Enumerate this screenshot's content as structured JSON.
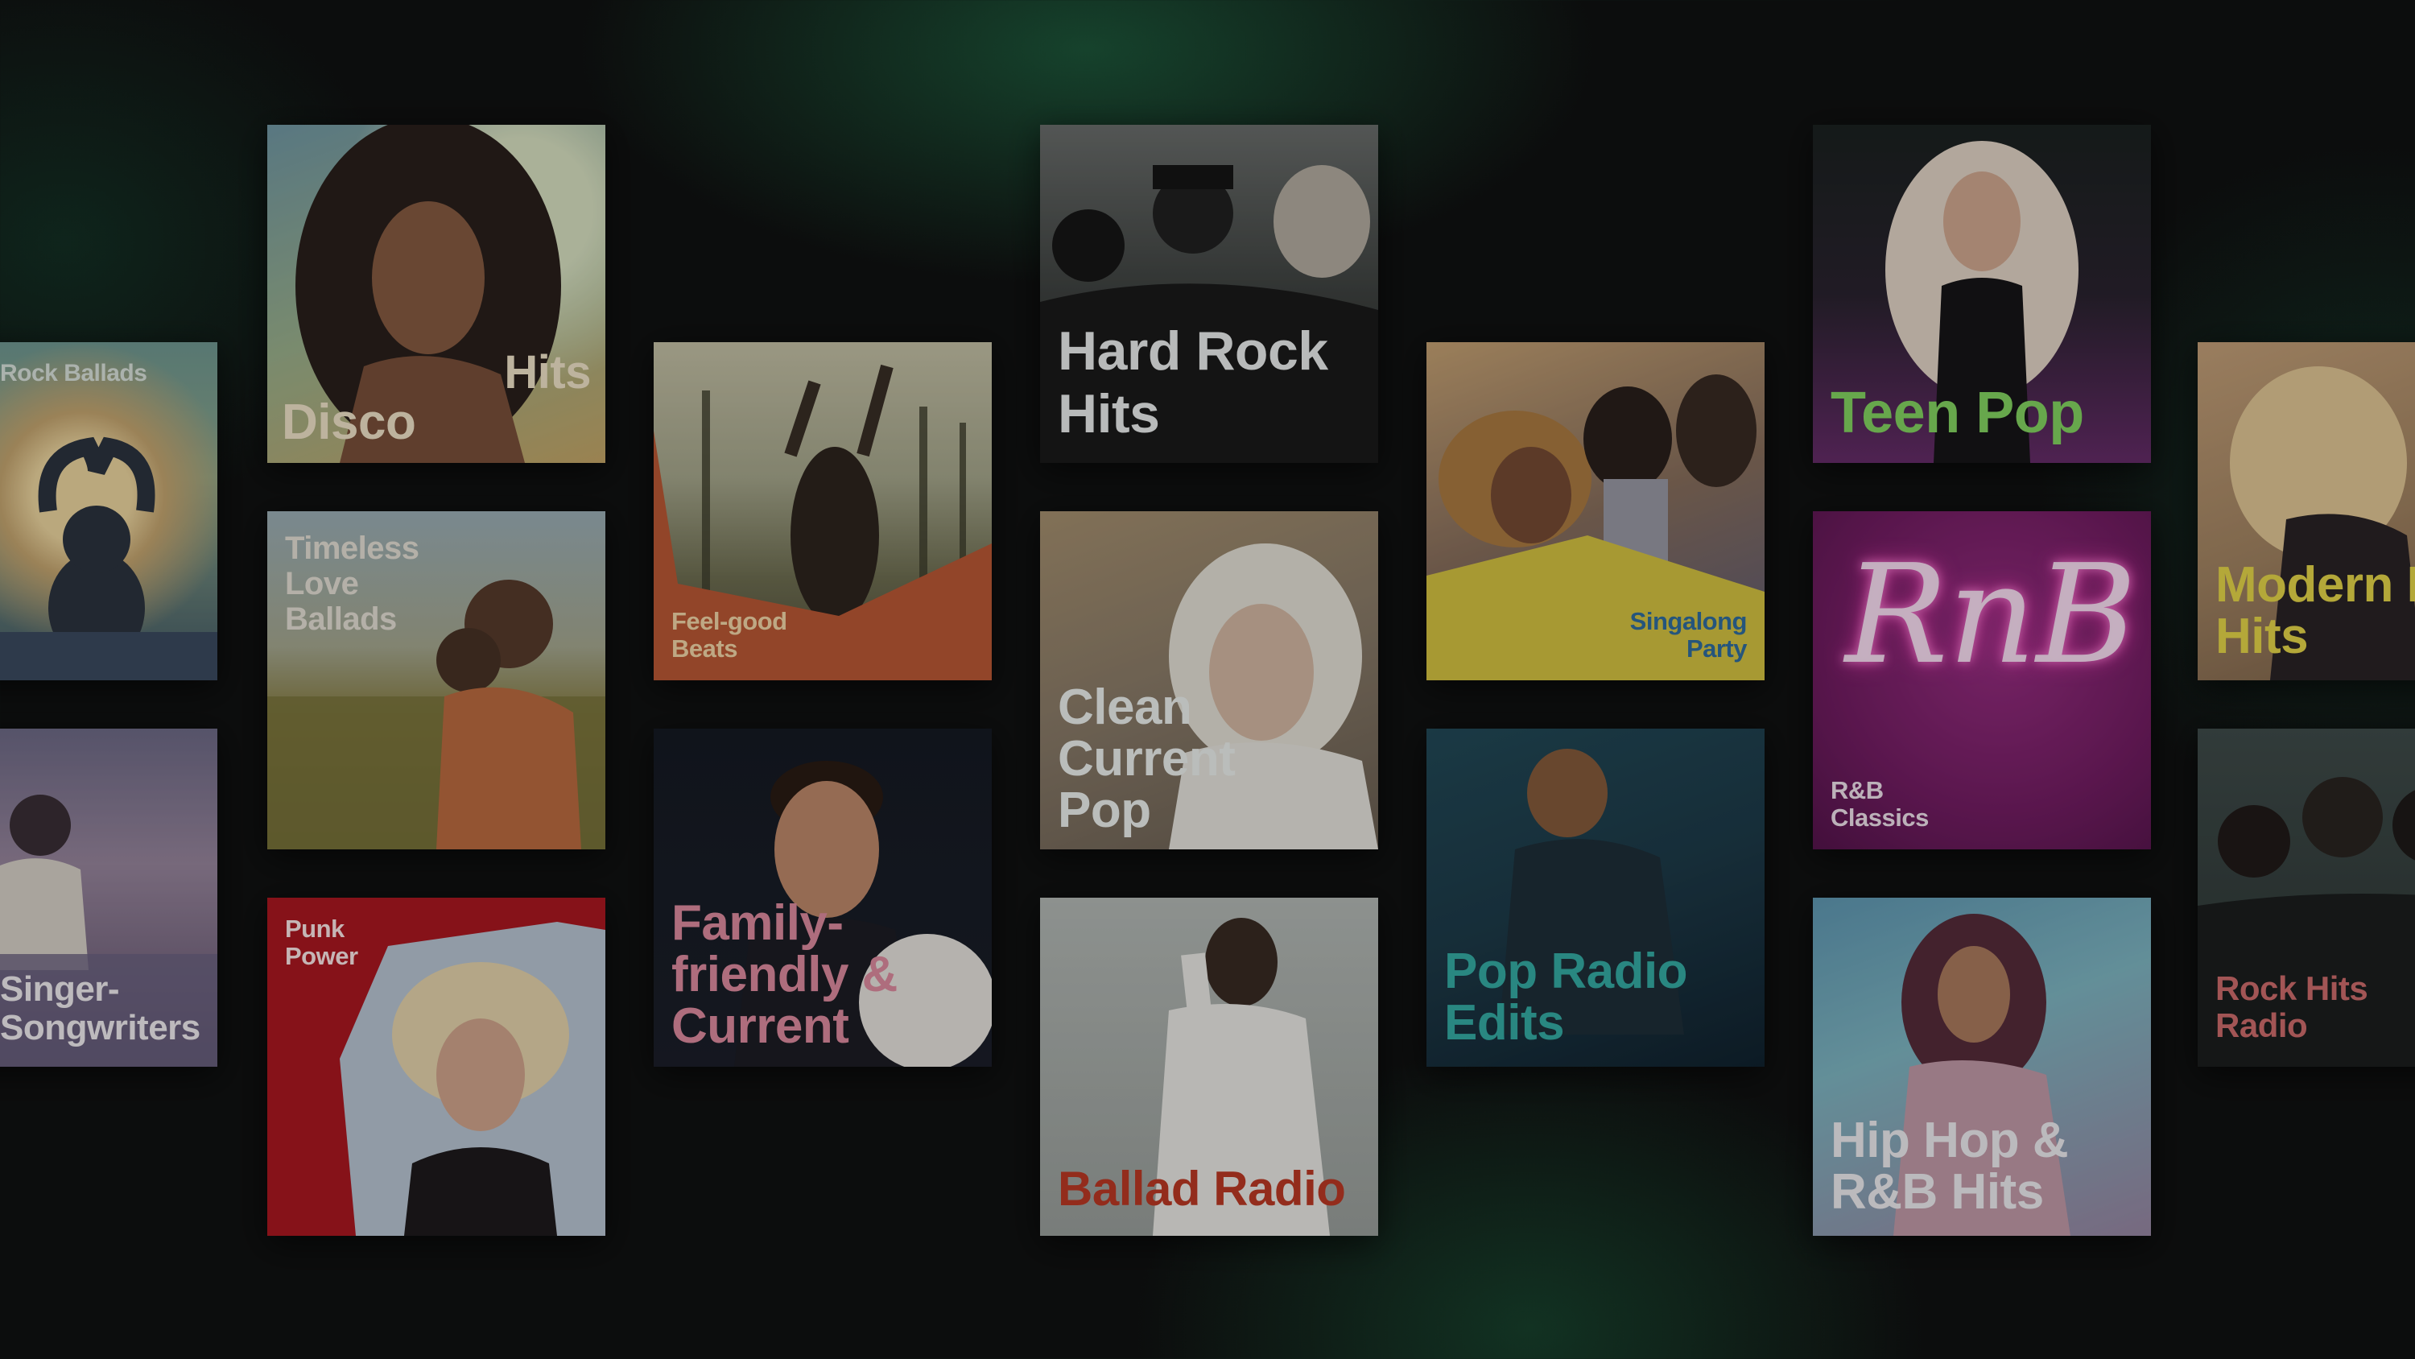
{
  "playlists": {
    "rock_ballads": {
      "title": "Rock Ballads"
    },
    "singer_songwriters": {
      "title": "Singer-Songwriters"
    },
    "disco_hits": {
      "title_word1": "Hits",
      "title_word2": "Disco"
    },
    "timeless_love_ballads": {
      "title": "Timeless Love Ballads"
    },
    "punk_power": {
      "title": "Punk Power"
    },
    "feel_good_beats": {
      "title": "Feel-good Beats"
    },
    "family_friendly_current": {
      "title": "Family-friendly & Current"
    },
    "hard_rock_hits": {
      "title": "Hard Rock Hits"
    },
    "clean_current_pop": {
      "title": "Clean Current Pop"
    },
    "ballad_radio": {
      "title": "Ballad Radio"
    },
    "singalong_party": {
      "title": "Singalong Party"
    },
    "pop_radio_edits": {
      "title": "Pop Radio Edits"
    },
    "teen_pop": {
      "title": "Teen Pop"
    },
    "rnb_classics": {
      "title": "R&B Classics",
      "neon_script": "RnB"
    },
    "hip_hop_rnb_hits": {
      "title": "Hip Hop & R&B Hits"
    },
    "modern_pop_hits": {
      "title": "Modern Pop Hits"
    },
    "rock_hits_radio": {
      "title": "Rock Hits Radio"
    }
  },
  "colors": {
    "background": "#0c0d0d",
    "accent_green": "#1e6e46",
    "punk_red": "#b8141e",
    "feel_good_orange": "#c4572e",
    "singalong_yellow": "#d9c534",
    "rnb_magenta": "#8c1e72",
    "teen_pop_green": "#7ed957"
  }
}
